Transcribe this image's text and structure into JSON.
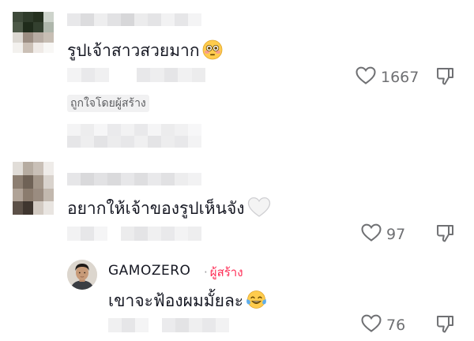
{
  "comments": [
    {
      "text": "รูปเจ้าสาวสวยมาก",
      "emoji": "flushed-face",
      "like_count": "1667",
      "badge": "ถูกใจโดยผู้สร้าง"
    },
    {
      "text": "อยากให้เจ้าของรูปเห็นจัง",
      "emoji": "white-heart",
      "like_count": "97"
    }
  ],
  "reply": {
    "username": "GAMOZERO",
    "separator": "·",
    "creator_label": "ผู้สร้าง",
    "text": "เขาจะฟ้องผมมั้ยละ",
    "emoji": "tears-of-joy-face",
    "like_count": "76"
  },
  "colors": {
    "creator_accent": "#fe2c55",
    "text": "#161823",
    "meta": "#6f7073"
  }
}
